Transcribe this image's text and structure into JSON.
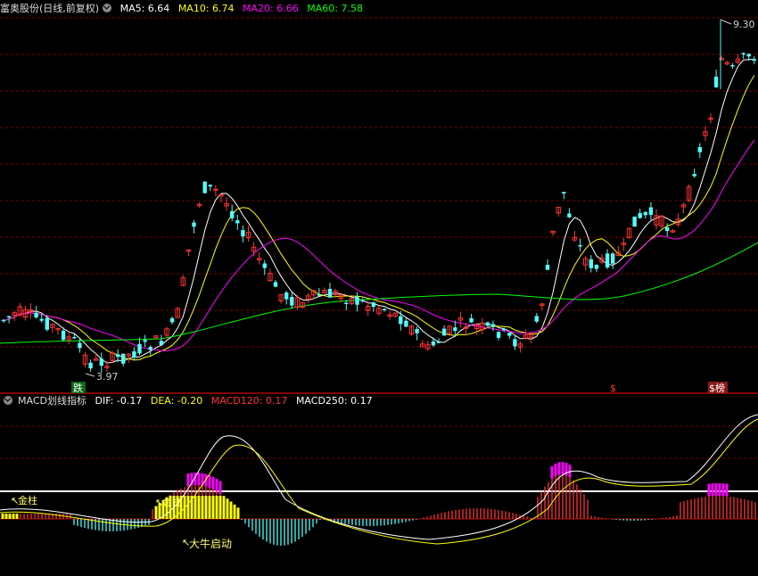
{
  "main": {
    "title": "富奥股份(日线,前复权)",
    "ma": [
      {
        "label": "MA5: 6.64",
        "color": "#ffffff"
      },
      {
        "label": "MA10: 6.74",
        "color": "#ffff00"
      },
      {
        "label": "MA20: 6.66",
        "color": "#ff00ff"
      },
      {
        "label": "MA60: 7.58",
        "color": "#00ff00"
      }
    ],
    "high_label": "9.30",
    "low_label": "3.97",
    "signals": [
      "跌",
      "$",
      "$榜"
    ]
  },
  "sub": {
    "title": "MACD划线指标",
    "values": [
      {
        "label": "DIF: -0.17",
        "color": "#ffffff"
      },
      {
        "label": "DEA: -0.20",
        "color": "#ffff00"
      },
      {
        "label": "MACD120: 0.17",
        "color": "#ff3333"
      },
      {
        "label": "MACD250: 0.17",
        "color": "#ffffff"
      }
    ],
    "annotations": [
      "金柱",
      "金柱",
      "大牛启动"
    ]
  },
  "colors": {
    "up": "#ff3333",
    "down": "#54fcfc",
    "grid": "#7a0000"
  }
}
